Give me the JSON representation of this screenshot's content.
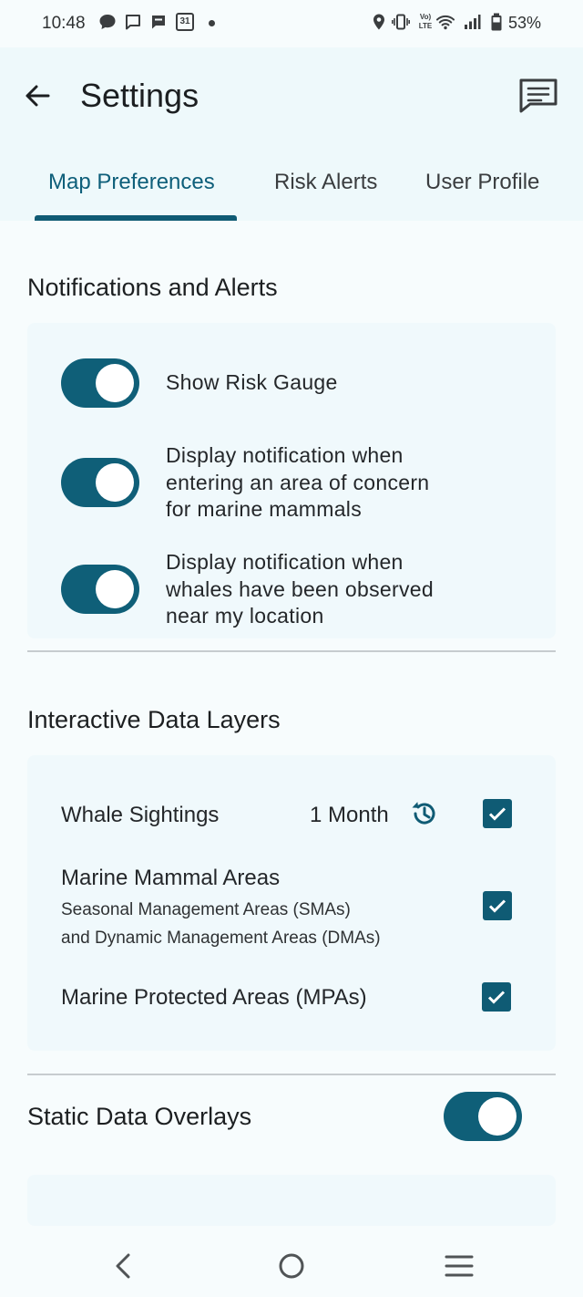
{
  "status_bar": {
    "time": "10:48",
    "battery": "53%",
    "left_icons": [
      "chat-bubble-icon",
      "message-icon",
      "message-filled-icon",
      "calendar-icon",
      "dot-icon"
    ],
    "calendar_day": "31",
    "right_icons": [
      "location-icon",
      "vibrate-icon",
      "volte-icon",
      "wifi-icon",
      "signal-icon",
      "battery-icon"
    ],
    "volte_label": "Vo) LTE"
  },
  "header": {
    "title": "Settings",
    "back_icon": "arrow-left-icon",
    "feedback_icon": "feedback-icon"
  },
  "tabs": [
    {
      "label": "Map Preferences",
      "active": true
    },
    {
      "label": "Risk Alerts",
      "active": false
    },
    {
      "label": "User Profile",
      "active": false
    }
  ],
  "notifications": {
    "title": "Notifications and Alerts",
    "items": [
      {
        "lines": [
          "Show Risk Gauge"
        ],
        "on": true
      },
      {
        "lines": [
          "Display notification when",
          "entering an area of concern",
          "for marine mammals"
        ],
        "on": true
      },
      {
        "lines": [
          "Display notification when",
          "whales have been observed",
          "near my location"
        ],
        "on": true
      }
    ]
  },
  "layers": {
    "title": "Interactive Data Layers",
    "whale": {
      "label": "Whale Sightings",
      "period": "1 Month",
      "history_icon": "history-icon",
      "checked": true
    },
    "mammal": {
      "label": "Marine Mammal Areas",
      "sub1": "Seasonal Management Areas (SMAs)",
      "sub2": "and Dynamic Management Areas (DMAs)",
      "checked": true
    },
    "protected": {
      "label": "Marine Protected Areas (MPAs)",
      "checked": true
    }
  },
  "overlays": {
    "title": "Static Data Overlays",
    "on": true
  },
  "nav": {
    "back": "nav-back-icon",
    "home": "nav-home-icon",
    "menu": "nav-menu-icon"
  },
  "colors": {
    "accent": "#0f5b74",
    "background": "#f7fcfd",
    "card": "#f0f9fc"
  }
}
